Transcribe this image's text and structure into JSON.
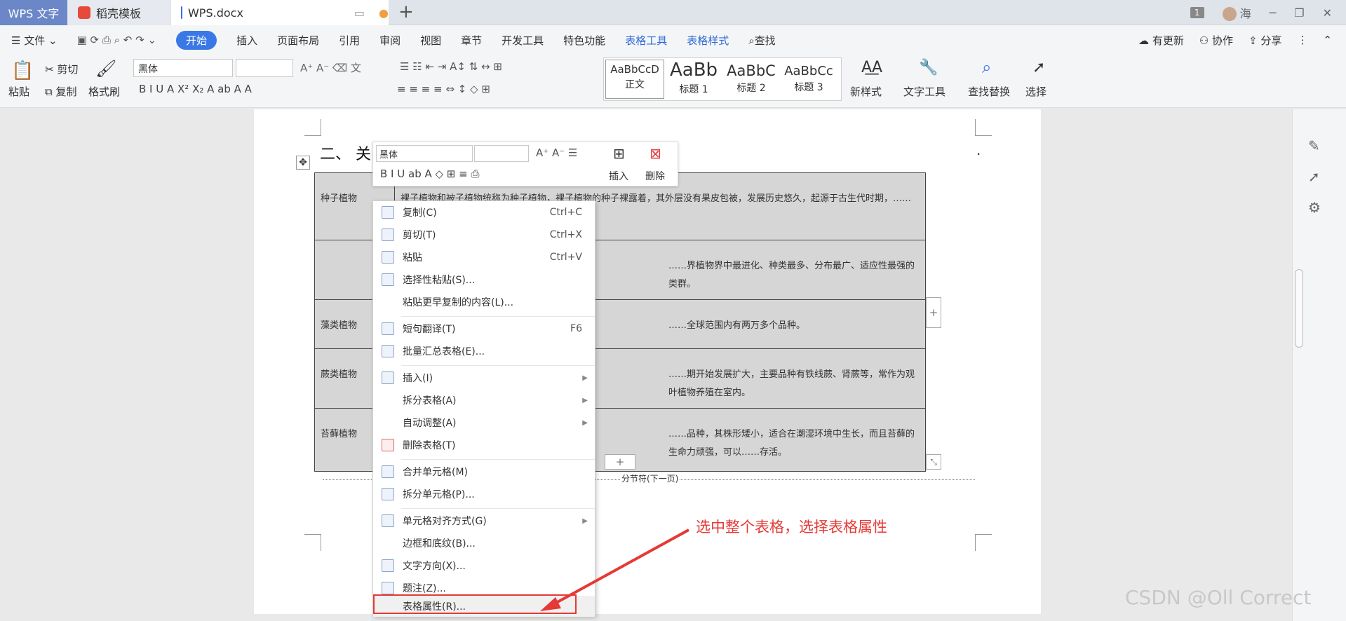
{
  "tabs": {
    "wps": "WPS 文字",
    "docer": "稻壳模板",
    "doc": "WPS.docx",
    "add": "+"
  },
  "window": {
    "badge": "1",
    "user": "海",
    "minimize": "─",
    "restore": "❐",
    "close": "✕"
  },
  "menubar": {
    "file": "文件",
    "items": [
      "开始",
      "插入",
      "页面布局",
      "引用",
      "审阅",
      "视图",
      "章节",
      "开发工具",
      "特色功能"
    ],
    "table_tools": "表格工具",
    "table_style": "表格样式",
    "search": "查找",
    "update": "有更新",
    "collab": "协作",
    "share": "分享"
  },
  "ribbon": {
    "paste": "粘贴",
    "cut": "剪切",
    "copy": "复制",
    "format_painter": "格式刷",
    "font": "黑体",
    "styles": [
      {
        "sample": "AaBbCcD",
        "name": "正文"
      },
      {
        "sample": "AaBb",
        "name": "标题 1"
      },
      {
        "sample": "AaBbC",
        "name": "标题 2"
      },
      {
        "sample": "AaBbCc",
        "name": "标题 3"
      }
    ],
    "new_style": "新样式",
    "text_tool": "文字工具",
    "find_replace": "查找替换",
    "select": "选择"
  },
  "doc": {
    "heading": "二、 关",
    "table": [
      [
        "种子植物",
        "裸子植物和被子植物统称为种子植物，裸子植物的种子裸露着，其外层没有果皮包被，发展历史悠久，起源于古生代时期，……"
      ],
      [
        "",
        "……界植物界中最进化、种类最多、分布最广、适应性最强的类群。"
      ],
      [
        "藻类植物",
        "……全球范围内有两万多个品种。"
      ],
      [
        "蕨类植物",
        "……期开始发展扩大，主要品种有铁线蕨、肾蕨等，常作为观叶植物养殖在室内。"
      ],
      [
        "苔藓植物",
        "……品种，其株形矮小，适合在潮湿环境中生长，而且苔藓的生命力顽强，可以……存活。"
      ]
    ],
    "section_break": "分节符(下一页)"
  },
  "mini_toolbar": {
    "font": "黑体",
    "insert": "插入",
    "delete": "删除"
  },
  "context_menu": [
    {
      "label": "复制(C)",
      "shortcut": "Ctrl+C"
    },
    {
      "label": "剪切(T)",
      "shortcut": "Ctrl+X"
    },
    {
      "label": "粘贴",
      "shortcut": "Ctrl+V"
    },
    {
      "label": "选择性粘贴(S)...",
      "shortcut": ""
    },
    {
      "label": "粘贴更早复制的内容(L)...",
      "shortcut": ""
    },
    {
      "label": "短句翻译(T)",
      "shortcut": "F6"
    },
    {
      "label": "批量汇总表格(E)...",
      "shortcut": ""
    },
    {
      "label": "插入(I)",
      "shortcut": ""
    },
    {
      "label": "拆分表格(A)",
      "shortcut": ""
    },
    {
      "label": "自动调整(A)",
      "shortcut": ""
    },
    {
      "label": "删除表格(T)",
      "shortcut": ""
    },
    {
      "label": "合并单元格(M)",
      "shortcut": ""
    },
    {
      "label": "拆分单元格(P)...",
      "shortcut": ""
    },
    {
      "label": "单元格对齐方式(G)",
      "shortcut": ""
    },
    {
      "label": "边框和底纹(B)...",
      "shortcut": ""
    },
    {
      "label": "文字方向(X)...",
      "shortcut": ""
    },
    {
      "label": "题注(Z)...",
      "shortcut": ""
    },
    {
      "label": "表格属性(R)...",
      "shortcut": ""
    }
  ],
  "annotation": "选中整个表格，选择表格属性",
  "watermark": "CSDN @Oll Correct",
  "colors": {
    "accent": "#3a78e6",
    "annotation": "#e53935"
  }
}
